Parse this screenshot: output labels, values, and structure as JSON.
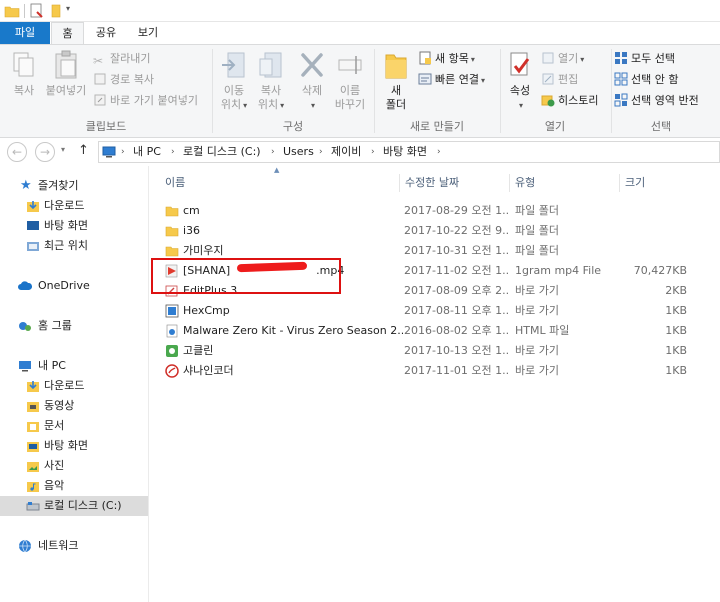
{
  "tabs": {
    "file": "파일",
    "home": "홈",
    "share": "공유",
    "view": "보기"
  },
  "ribbon": {
    "clipboard": {
      "label": "클립보드",
      "copy": "복사",
      "paste": "붙여넣기",
      "cut": "잘라내기",
      "copy_path": "경로 복사",
      "paste_shortcut": "바로 가기 붙여넣기"
    },
    "organize": {
      "label": "구성",
      "move_to": "이동",
      "move_to_sub": "위치",
      "copy_to": "복사",
      "copy_to_sub": "위치",
      "delete": "삭제",
      "rename": "이름",
      "rename_sub": "바꾸기"
    },
    "new": {
      "label": "새로 만들기",
      "new_folder": "새",
      "new_folder_sub": "폴더",
      "new_item": "새 항목",
      "easy_access": "빠른 연결"
    },
    "open": {
      "label": "열기",
      "properties": "속성",
      "open": "열기",
      "edit": "편집",
      "history": "히스토리"
    },
    "select": {
      "label": "선택",
      "select_all": "모두 선택",
      "select_none": "선택 안 함",
      "invert": "선택 영역 반전"
    }
  },
  "address": {
    "crumbs": [
      "내 PC",
      "로컬 디스크 (C:)",
      "Users",
      "제이비",
      "바탕 화면"
    ]
  },
  "nav": {
    "quick_access": "즐겨찾기",
    "downloads": "다운로드",
    "desktop": "바탕 화면",
    "recent": "최근 위치",
    "onedrive": "OneDrive",
    "homegroup": "홈 그룹",
    "this_pc": "내 PC",
    "pc_downloads": "다운로드",
    "videos": "동영상",
    "documents": "문서",
    "pc_desktop": "바탕 화면",
    "pictures": "사진",
    "music": "음악",
    "local_disk": "로컬 디스크 (C:)",
    "network": "네트워크"
  },
  "columns": {
    "name": "이름",
    "date": "수정한 날짜",
    "type": "유형",
    "size": "크기"
  },
  "files": [
    {
      "name": "cm",
      "date": "2017-08-29 오전 1...",
      "type": "파일 폴더",
      "size": "",
      "icon": "folder-icon"
    },
    {
      "name": "i36",
      "date": "2017-10-22 오전 9...",
      "type": "파일 폴더",
      "size": "",
      "icon": "folder-icon"
    },
    {
      "name": "가미우지",
      "date": "2017-10-31 오전 1...",
      "type": "파일 폴더",
      "size": "",
      "icon": "folder-icon"
    },
    {
      "name": "[SHANA]",
      "name_tail": ".mp4",
      "date": "2017-11-02 오전 1...",
      "type": "1gram mp4 File",
      "size": "70,427KB",
      "icon": "video-file-icon"
    },
    {
      "name": "EditPlus 3",
      "date": "2017-08-09 오후 2...",
      "type": "바로 가기",
      "size": "2KB",
      "icon": "editplus-icon"
    },
    {
      "name": "HexCmp",
      "date": "2017-08-11 오후 1...",
      "type": "바로 가기",
      "size": "1KB",
      "icon": "hexcmp-icon"
    },
    {
      "name": "Malware Zero Kit - Virus Zero Season 2...",
      "date": "2016-08-02 오후 1...",
      "type": "HTML 파일",
      "size": "1KB",
      "icon": "html-file-icon"
    },
    {
      "name": "고클린",
      "date": "2017-10-13 오전 1...",
      "type": "바로 가기",
      "size": "1KB",
      "icon": "goclean-icon"
    },
    {
      "name": "샤나인코더",
      "date": "2017-11-01 오전 1...",
      "type": "바로 가기",
      "size": "1KB",
      "icon": "shana-encoder-icon"
    }
  ],
  "colors": {
    "accent": "#1979ca",
    "folder": "#f6c94b",
    "highlight": "#dd1111"
  }
}
